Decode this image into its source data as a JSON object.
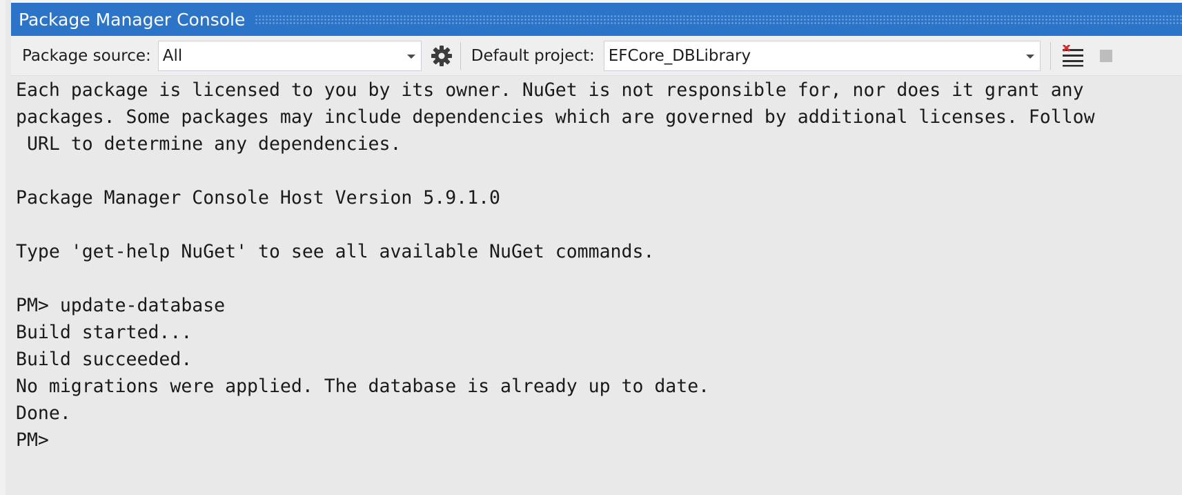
{
  "window": {
    "title": "Package Manager Console"
  },
  "toolbar": {
    "package_source_label": "Package source:",
    "package_source_value": "All",
    "settings_icon": "gear-icon",
    "default_project_label": "Default project:",
    "default_project_value": "EFCore_DBLibrary",
    "clear_icon": "clear-console-icon",
    "stop_icon": "stop-icon"
  },
  "console": {
    "lines": [
      "Each package is licensed to you by its owner. NuGet is not responsible for, nor does it grant any",
      "packages. Some packages may include dependencies which are governed by additional licenses. Follow",
      " URL to determine any dependencies.",
      "",
      "Package Manager Console Host Version 5.9.1.0",
      "",
      "Type 'get-help NuGet' to see all available NuGet commands.",
      "",
      "PM> update-database",
      "Build started...",
      "Build succeeded.",
      "No migrations were applied. The database is already up to date.",
      "Done.",
      "PM>"
    ]
  }
}
